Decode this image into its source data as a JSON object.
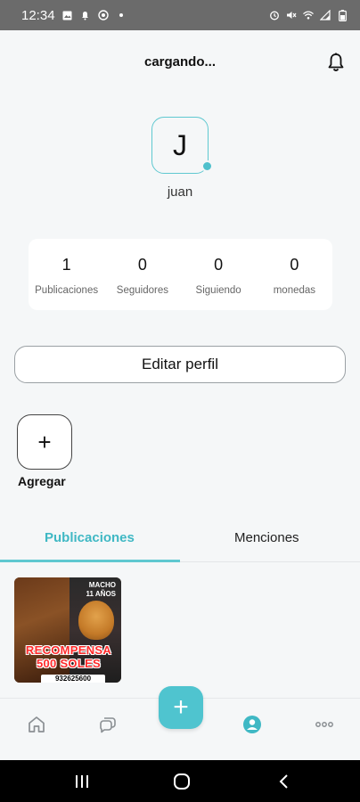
{
  "status_bar": {
    "time": "12:34",
    "left_icons": [
      "image-icon",
      "notification-icon",
      "whatsapp-icon",
      "dot-icon"
    ],
    "right_icons": [
      "alarm-icon",
      "mute-icon",
      "wifi-icon",
      "signal-icon",
      "battery-icon"
    ]
  },
  "header": {
    "title": "cargando...",
    "bell_icon": "bell-icon"
  },
  "profile": {
    "avatar_letter": "J",
    "username": "juan",
    "accent_color": "#4fc0cc"
  },
  "stats": [
    {
      "value": "1",
      "label": "Publicaciones"
    },
    {
      "value": "0",
      "label": "Seguidores"
    },
    {
      "value": "0",
      "label": "Siguiendo"
    },
    {
      "value": "0",
      "label": "monedas"
    }
  ],
  "edit_button": {
    "label": "Editar perfil"
  },
  "add_story": {
    "symbol": "+",
    "label": "Agregar"
  },
  "tabs": [
    {
      "label": "Publicaciones",
      "active": true
    },
    {
      "label": "Menciones",
      "active": false
    }
  ],
  "post": {
    "badge_line1": "MACHO",
    "badge_line2": "11 AÑOS",
    "reward_line1": "RECOMPENSA",
    "reward_line2": "500 SOLES",
    "phone": "932625600"
  },
  "bottom_nav": {
    "items": [
      "home-icon",
      "chat-icon",
      "add-icon",
      "profile-icon",
      "more-icon"
    ],
    "fab_symbol": "+"
  },
  "system_nav": [
    "recents-icon",
    "home-icon",
    "back-icon"
  ]
}
